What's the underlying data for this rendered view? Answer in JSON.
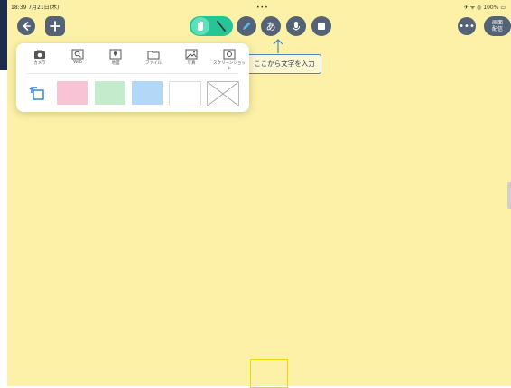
{
  "status": {
    "time_date": "18:39  7月21日(木)",
    "dots": "•••",
    "right": "✈ ᯤ ◎ 100% ▭"
  },
  "toolbar": {
    "back_icon": "arrow-left-icon",
    "add_icon": "plus-icon",
    "hand_tool": "hand-icon",
    "pen_tool": "pen-icon",
    "kana_label": "あ",
    "mic_tool": "microphone-icon",
    "shape_tool": "square-icon",
    "more_label": "•••",
    "broadcast_line1": "画面",
    "broadcast_line2": "配信"
  },
  "tooltip": {
    "text": "ここから文字を入力"
  },
  "popup": {
    "items": [
      {
        "label": "カメラ",
        "icon": "camera-icon"
      },
      {
        "label": "Web",
        "icon": "web-search-icon"
      },
      {
        "label": "地図",
        "icon": "map-icon"
      },
      {
        "label": "ファイル",
        "icon": "folder-icon"
      },
      {
        "label": "写真",
        "icon": "photo-icon"
      },
      {
        "label": "スクリーンショット",
        "icon": "screenshot-icon"
      }
    ],
    "cards": [
      {
        "name": "pink",
        "color": "#f9c3d6"
      },
      {
        "name": "green",
        "color": "#c3ebcc"
      },
      {
        "name": "blue",
        "color": "#b2d7f7"
      },
      {
        "name": "white",
        "color": "#ffffff"
      },
      {
        "name": "transparent",
        "color": "#ffffff"
      }
    ]
  },
  "colors": {
    "canvas": "#fcf1a6",
    "toolbar_button": "#546275",
    "accent_green": "#27c498"
  }
}
